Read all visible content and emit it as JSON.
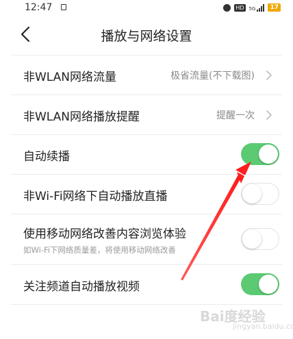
{
  "status_bar": {
    "time": "12:47",
    "hd_label": "HD",
    "network_label": "5G",
    "battery": "17"
  },
  "nav": {
    "title": "播放与网络设置"
  },
  "settings": {
    "rows": [
      {
        "label": "非WLAN网络流量",
        "value": "极省流量(不下载图)"
      },
      {
        "label": "非WLAN网络播放提醒",
        "value": "提醒一次"
      },
      {
        "label": "自动续播",
        "toggle": true
      },
      {
        "label": "非Wi-Fi网络下自动播放直播",
        "toggle": false
      },
      {
        "label": "使用移动网络改善内容浏览体验",
        "sublabel": "如Wi-Fi下网络质量差，将使用移动网络改善",
        "toggle": false
      },
      {
        "label": "关注频道自动播放视频",
        "toggle": true
      }
    ]
  },
  "colors": {
    "toggle_on": "#5bca73",
    "annotation_arrow": "#ff2a2a"
  },
  "icons": {
    "back": "chevron-left-icon",
    "row_arrow": "chevron-right-icon"
  },
  "watermark": {
    "text": "Bai度经验",
    "sub": "jingyan.baidu.com"
  }
}
